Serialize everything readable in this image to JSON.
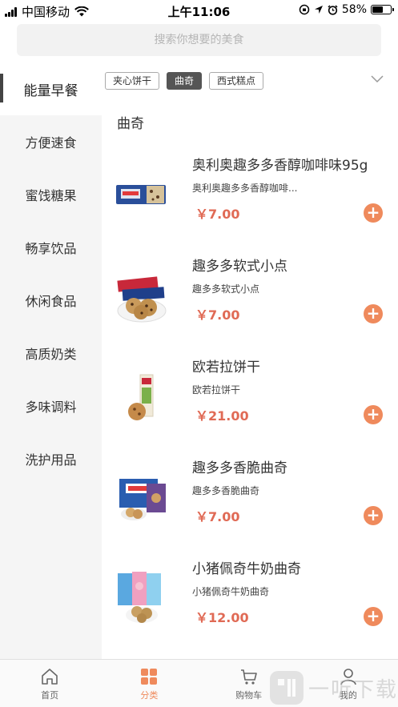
{
  "status_bar": {
    "carrier": "中国移动",
    "time": "上午11:06",
    "battery": "58%",
    "battery_level": 0.58
  },
  "search": {
    "placeholder": "搜索你想要的美食"
  },
  "sidebar": {
    "items": [
      {
        "label": "能量早餐",
        "active": true
      },
      {
        "label": "方便速食"
      },
      {
        "label": "蜜饯糖果"
      },
      {
        "label": "畅享饮品"
      },
      {
        "label": "休闲食品"
      },
      {
        "label": "高质奶类"
      },
      {
        "label": "多味调料"
      },
      {
        "label": "洗护用品"
      }
    ]
  },
  "tags": [
    {
      "label": "夹心饼干"
    },
    {
      "label": "曲奇",
      "active": true
    },
    {
      "label": "西式糕点"
    }
  ],
  "section_title": "曲奇",
  "products": [
    {
      "name": "奥利奥趣多多香醇咖啡味95g",
      "desc": "奥利奥趣多多香醇咖啡...",
      "price": "￥7.00"
    },
    {
      "name": "趣多多软式小点",
      "desc": "趣多多软式小点",
      "price": "￥7.00"
    },
    {
      "name": "欧若拉饼干",
      "desc": "欧若拉饼干",
      "price": "￥21.00"
    },
    {
      "name": "趣多多香脆曲奇",
      "desc": "趣多多香脆曲奇",
      "price": "￥7.00"
    },
    {
      "name": "小猪佩奇牛奶曲奇",
      "desc": "小猪佩奇牛奶曲奇",
      "price": "￥12.00"
    }
  ],
  "tabbar": {
    "items": [
      {
        "label": "首页",
        "icon": "home-icon"
      },
      {
        "label": "分类",
        "icon": "category-icon",
        "active": true
      },
      {
        "label": "购物车",
        "icon": "cart-icon"
      },
      {
        "label": "我的",
        "icon": "user-icon"
      }
    ]
  },
  "watermark": {
    "text": "一听下载"
  },
  "colors": {
    "accent": "#ef8a5c",
    "price": "#e06a55"
  }
}
